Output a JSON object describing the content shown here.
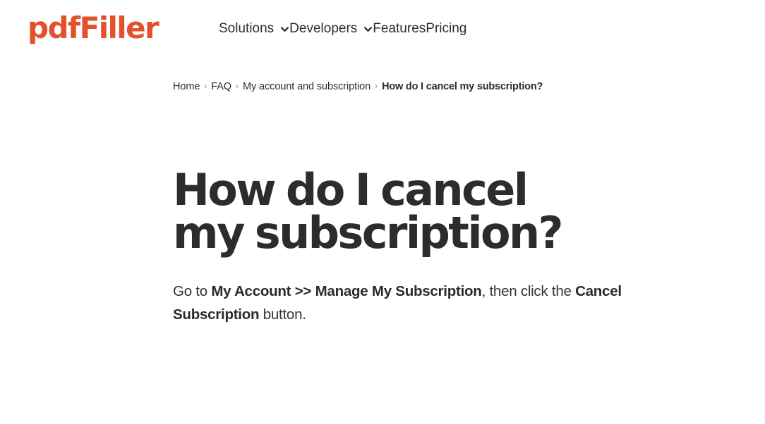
{
  "brand": {
    "logo_text": "pdfFiller",
    "accent_color": "#E2512B"
  },
  "nav": {
    "items": [
      {
        "label": "Solutions",
        "has_dropdown": true
      },
      {
        "label": "Developers",
        "has_dropdown": true
      },
      {
        "label": "Features",
        "has_dropdown": false
      },
      {
        "label": "Pricing",
        "has_dropdown": false
      }
    ]
  },
  "breadcrumb": {
    "separator": "›",
    "items": [
      {
        "label": "Home",
        "current": false
      },
      {
        "label": "FAQ",
        "current": false
      },
      {
        "label": "My account and subscription",
        "current": false
      },
      {
        "label": "How do I cancel my subscription?",
        "current": true
      }
    ]
  },
  "main": {
    "title": "How do I cancel my subscription?",
    "answer": {
      "part1": "Go to ",
      "bold1": "My Account >> Manage My Subscription",
      "part2": ", then click the ",
      "bold2": "Cancel Subscription",
      "part3": " button."
    }
  },
  "colors": {
    "text_dark": "#2c2c2c",
    "text_body": "#333333",
    "background": "#ffffff"
  }
}
